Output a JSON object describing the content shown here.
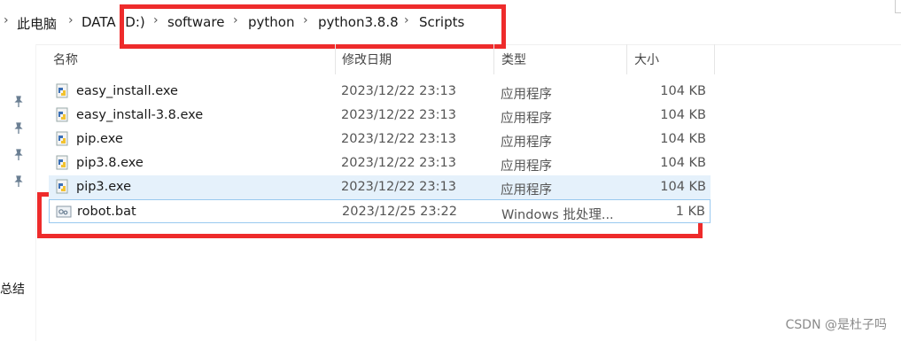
{
  "breadcrumb": {
    "items": [
      "此电脑",
      "DATA (D:)",
      "software",
      "python",
      "python3.8.8",
      "Scripts"
    ],
    "separator": "›"
  },
  "columns": {
    "name": "名称",
    "date": "修改日期",
    "type": "类型",
    "size": "大小"
  },
  "files": [
    {
      "name": "easy_install.exe",
      "date": "2023/12/22 23:13",
      "type": "应用程序",
      "size": "104 KB",
      "icon": "python-exe-icon"
    },
    {
      "name": "easy_install-3.8.exe",
      "date": "2023/12/22 23:13",
      "type": "应用程序",
      "size": "104 KB",
      "icon": "python-exe-icon"
    },
    {
      "name": "pip.exe",
      "date": "2023/12/22 23:13",
      "type": "应用程序",
      "size": "104 KB",
      "icon": "python-exe-icon"
    },
    {
      "name": "pip3.8.exe",
      "date": "2023/12/22 23:13",
      "type": "应用程序",
      "size": "104 KB",
      "icon": "python-exe-icon"
    },
    {
      "name": "pip3.exe",
      "date": "2023/12/22 23:13",
      "type": "应用程序",
      "size": "104 KB",
      "icon": "python-exe-icon"
    },
    {
      "name": "robot.bat",
      "date": "2023/12/25 23:22",
      "type": "Windows 批处理...",
      "size": "1 KB",
      "icon": "batch-file-icon"
    }
  ],
  "sidebar": {
    "partial_label": "总结"
  },
  "watermark": "CSDN @是杜子吗",
  "colors": {
    "highlight": "#ee2b2b",
    "selection": "#e5f1fb",
    "focus_border": "#99c9ef"
  }
}
